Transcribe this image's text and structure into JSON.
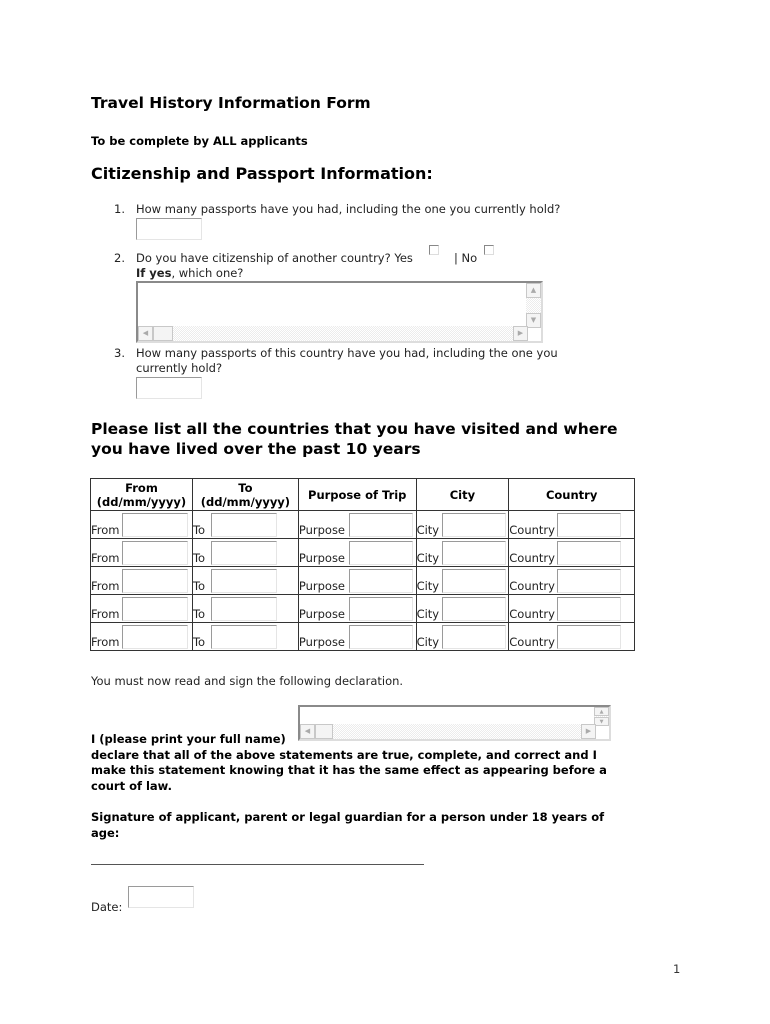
{
  "document": {
    "title": "Travel History Information Form",
    "subtitle": "To be complete by ALL applicants",
    "page_number": "1"
  },
  "citizenship": {
    "heading": "Citizenship and Passport Information:",
    "questions": [
      {
        "number": "1.",
        "text": "How many passports have you had, including the one you currently hold?",
        "value": ""
      },
      {
        "number": "2.",
        "text": "Do you have citizenship of another country? Yes",
        "no_label": "| No",
        "yes_checked": false,
        "no_checked": false,
        "followup_bold": "If yes",
        "followup_rest": ", which one?",
        "value": ""
      },
      {
        "number": "3.",
        "text_line1": "How many passports of this country have you had, including the one you",
        "text_line2": "currently hold?",
        "value": ""
      }
    ]
  },
  "travel": {
    "heading": "Please list all the countries that you have visited and where you have lived over the past 10 years",
    "columns": [
      {
        "line1": "From",
        "line2": "(dd/mm/yyyy)"
      },
      {
        "line1": "To",
        "line2": "(dd/mm/yyyy)"
      },
      {
        "line1": "Purpose of Trip",
        "line2": ""
      },
      {
        "line1": "City",
        "line2": ""
      },
      {
        "line1": "Country",
        "line2": ""
      }
    ],
    "row_labels": [
      "From",
      "To",
      "Purpose",
      "City",
      "Country"
    ],
    "rows": [
      {
        "from": "",
        "to": "",
        "purpose": "",
        "city": "",
        "country": ""
      },
      {
        "from": "",
        "to": "",
        "purpose": "",
        "city": "",
        "country": ""
      },
      {
        "from": "",
        "to": "",
        "purpose": "",
        "city": "",
        "country": ""
      },
      {
        "from": "",
        "to": "",
        "purpose": "",
        "city": "",
        "country": ""
      },
      {
        "from": "",
        "to": "",
        "purpose": "",
        "city": "",
        "country": ""
      }
    ]
  },
  "declaration": {
    "intro": "You must now read and sign the following declaration.",
    "name_label": "I (please print your full name)",
    "name_value": "",
    "statement": "declare that all of the above statements are true, complete, and correct and I make this statement knowing that it has the same effect as appearing before a court of law.",
    "signature_label": "Signature of applicant, parent or legal guardian for a person under 18 years of age:",
    "date_label": "Date:",
    "date_value": ""
  },
  "icons": {
    "scroll_up": "▲",
    "scroll_down": "▼",
    "scroll_left": "◀",
    "scroll_right": "▶"
  }
}
